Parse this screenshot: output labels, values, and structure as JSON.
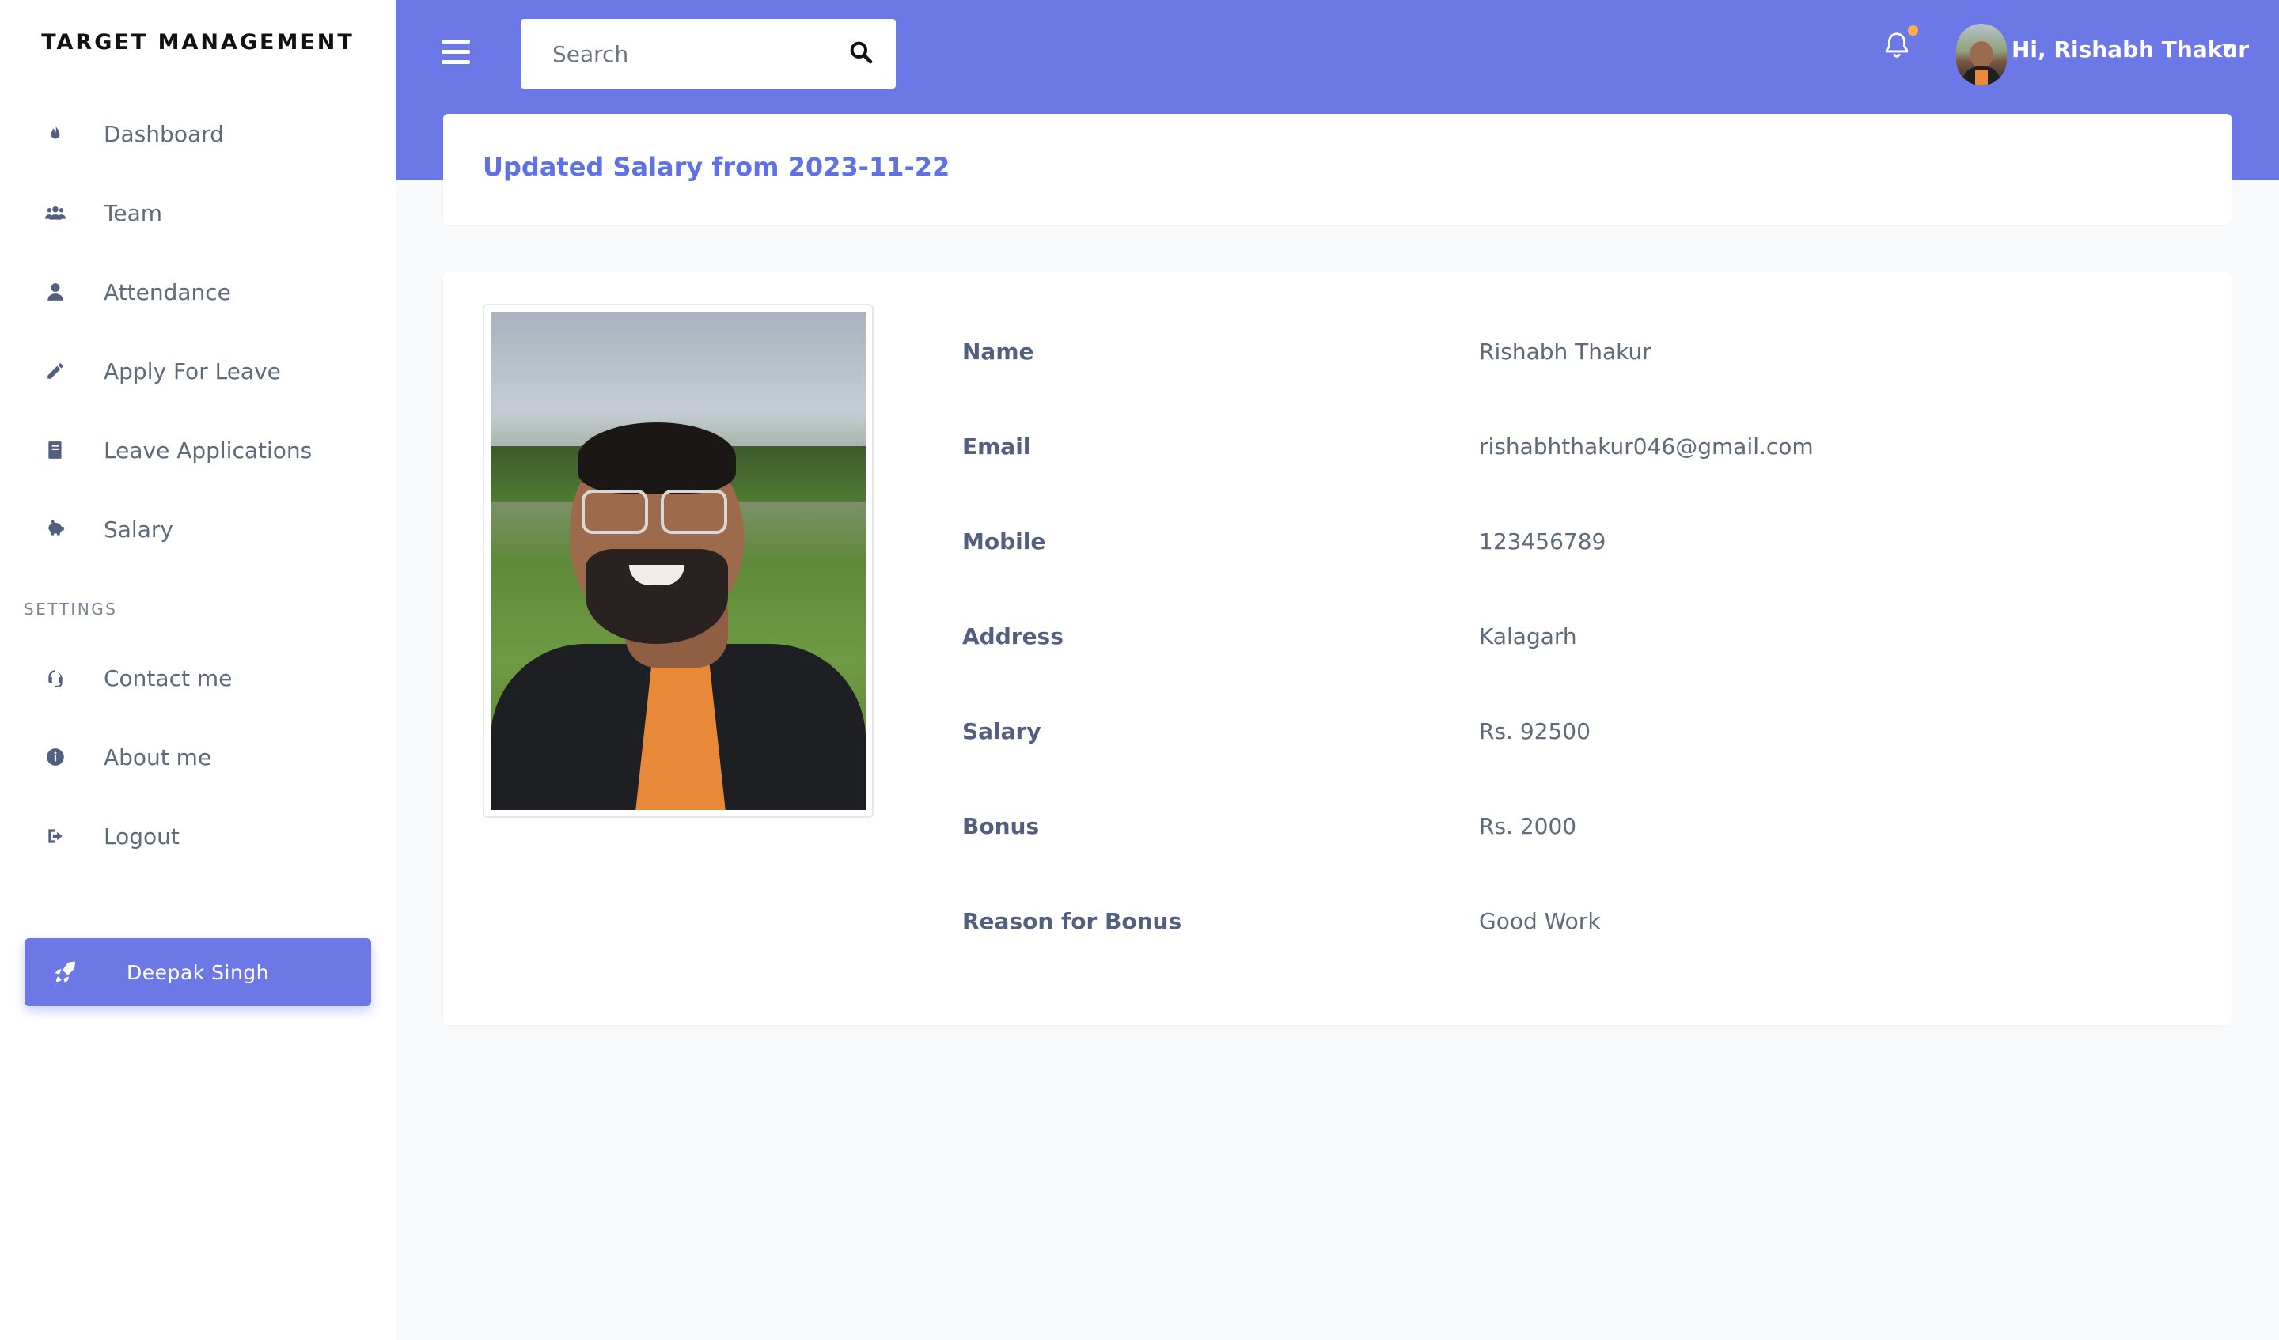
{
  "brand": "TARGET MANAGEMENT",
  "sidebar": {
    "items": [
      {
        "label": "Dashboard",
        "icon": "fire-icon"
      },
      {
        "label": "Team",
        "icon": "users-icon"
      },
      {
        "label": "Attendance",
        "icon": "user-icon"
      },
      {
        "label": "Apply For Leave",
        "icon": "pencil-icon"
      },
      {
        "label": "Leave Applications",
        "icon": "book-icon"
      },
      {
        "label": "Salary",
        "icon": "piggy-bank-icon"
      }
    ],
    "settings_heading": "SETTINGS",
    "settings_items": [
      {
        "label": "Contact me",
        "icon": "headset-icon"
      },
      {
        "label": "About me",
        "icon": "info-icon"
      },
      {
        "label": "Logout",
        "icon": "logout-icon"
      }
    ],
    "cta": {
      "label": "Deepak Singh",
      "icon": "rocket-icon"
    }
  },
  "header": {
    "search_placeholder": "Search",
    "user_greeting": "Hi, Rishabh Thakur",
    "accent_color": "#6b78e5",
    "notification_dot_color": "#ffad46"
  },
  "page": {
    "title": "Updated Salary from 2023-11-22"
  },
  "details": [
    {
      "label": "Name",
      "value": "Rishabh Thakur"
    },
    {
      "label": "Email",
      "value": "rishabhthakur046@gmail.com"
    },
    {
      "label": "Mobile",
      "value": "123456789"
    },
    {
      "label": "Address",
      "value": "Kalagarh"
    },
    {
      "label": "Salary",
      "value": "Rs. 92500"
    },
    {
      "label": "Bonus",
      "value": "Rs. 2000"
    },
    {
      "label": "Reason for Bonus",
      "value": "Good Work"
    }
  ]
}
